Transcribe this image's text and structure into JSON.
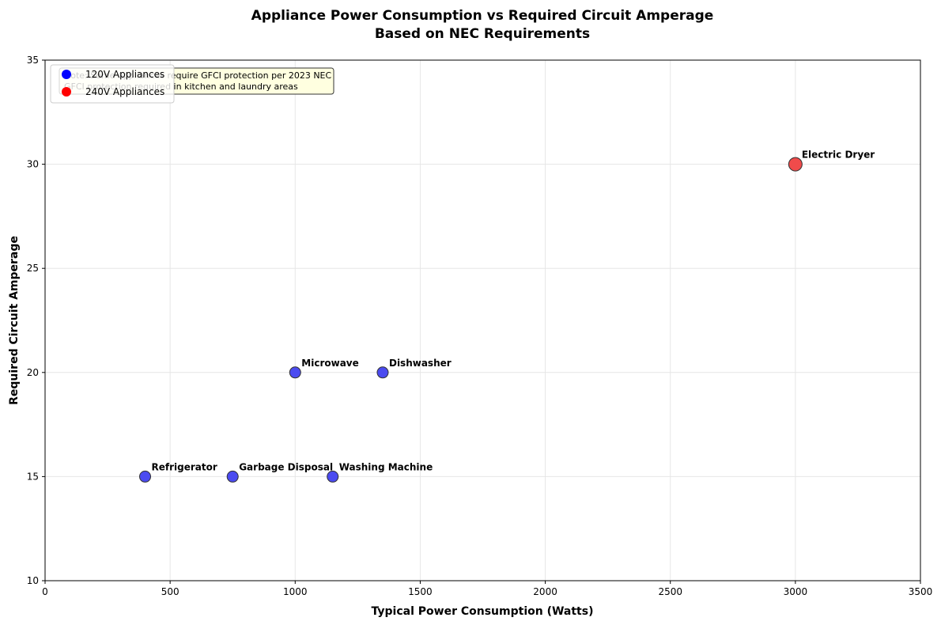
{
  "chart_data": {
    "type": "scatter",
    "title": "Appliance Power Consumption vs Required Circuit Amperage",
    "subtitle": "Based on NEC Requirements",
    "xlabel": "Typical Power Consumption (Watts)",
    "ylabel": "Required Circuit Amperage",
    "xlim": [
      0,
      3500
    ],
    "ylim": [
      10,
      35
    ],
    "xticks": [
      0,
      500,
      1000,
      1500,
      2000,
      2500,
      3000,
      3500
    ],
    "yticks": [
      10,
      15,
      20,
      25,
      30,
      35
    ],
    "grid": true,
    "legend_position": "top-left",
    "series": [
      {
        "name": "120V Appliances",
        "color": "#0000ff",
        "marker_color": "#4b4bf0",
        "points": [
          {
            "label": "Refrigerator",
            "x": 400,
            "y": 15
          },
          {
            "label": "Garbage Disposal",
            "x": 750,
            "y": 15
          },
          {
            "label": "Microwave",
            "x": 1000,
            "y": 20
          },
          {
            "label": "Washing Machine",
            "x": 1150,
            "y": 15
          },
          {
            "label": "Dishwasher",
            "x": 1350,
            "y": 20
          }
        ]
      },
      {
        "name": "240V Appliances",
        "color": "#ff0000",
        "marker_color": "#f04b4b",
        "points": [
          {
            "label": "Electric Dryer",
            "x": 3000,
            "y": 30
          }
        ]
      }
    ],
    "annotation": {
      "lines": [
        "Note: Some appliances require GFCI protection per 2023 NEC",
        "GFCI protection required in kitchen and laundry areas"
      ],
      "background": "#ffffe0"
    }
  }
}
